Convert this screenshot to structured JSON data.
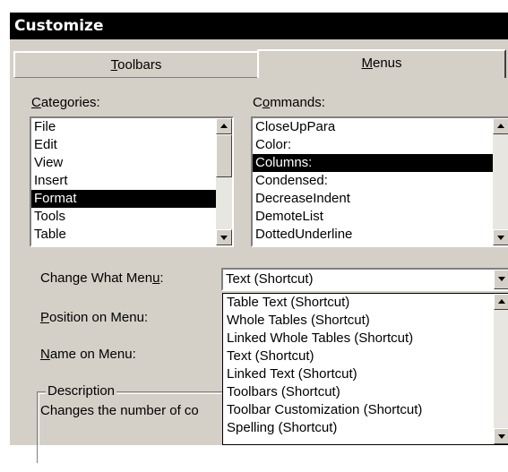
{
  "window": {
    "title": "Customize"
  },
  "tabs": [
    {
      "label_pre": "",
      "label_accel": "T",
      "label_post": "oolbars"
    },
    {
      "label_pre": "",
      "label_accel": "M",
      "label_post": "enus"
    }
  ],
  "categories": {
    "label_pre": "",
    "label_accel": "C",
    "label_post": "ategories:",
    "items": [
      "File",
      "Edit",
      "View",
      "Insert",
      "Format",
      "Tools",
      "Table"
    ],
    "selected": "Format"
  },
  "commands": {
    "label_pre": "C",
    "label_accel": "o",
    "label_post": "mmands:",
    "items": [
      "CloseUpPara",
      "Color:",
      "Columns:",
      "Condensed:",
      "DecreaseIndent",
      "DemoteList",
      "DottedUnderline"
    ],
    "selected": "Columns:"
  },
  "change_menu": {
    "label_pre": "Change What Men",
    "label_accel": "u",
    "label_post": ":",
    "value": "Text (Shortcut)",
    "options": [
      "Table Text (Shortcut)",
      "Whole Tables (Shortcut)",
      "Linked Whole Tables (Shortcut)",
      "Text (Shortcut)",
      "Linked Text (Shortcut)",
      "Toolbars (Shortcut)",
      "Toolbar Customization (Shortcut)",
      "Spelling (Shortcut)"
    ],
    "selected": "Text (Shortcut)"
  },
  "position_menu": {
    "label_pre": "",
    "label_accel": "P",
    "label_post": "osition on Menu:"
  },
  "name_menu": {
    "label_pre": "",
    "label_accel": "N",
    "label_post": "ame on Menu:"
  },
  "description": {
    "title": "Description",
    "text": "Changes the number of co"
  },
  "colors": {
    "selection": "#000000",
    "face": "#d4d0c8",
    "title_bg": "#000000"
  }
}
